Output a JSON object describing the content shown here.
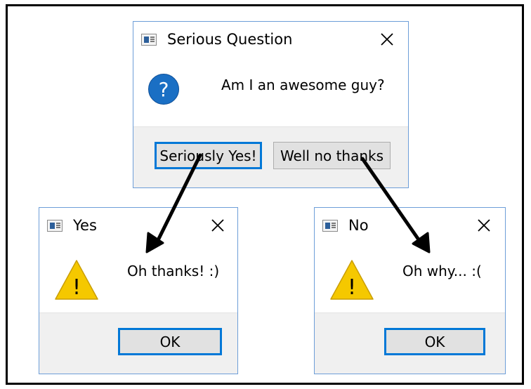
{
  "question_dialog": {
    "title": "Serious Question",
    "message": "Am I an awesome guy?",
    "yes_button": "Seriously Yes!",
    "no_button": "Well no thanks",
    "icon": "question-icon",
    "icon_glyph": "?"
  },
  "yes_dialog": {
    "title": "Yes",
    "message": "Oh thanks! :)",
    "ok_button": "OK",
    "icon": "warning-icon",
    "icon_glyph": "!"
  },
  "no_dialog": {
    "title": "No",
    "message": "Oh why... :(",
    "ok_button": "OK",
    "icon": "warning-icon",
    "icon_glyph": "!"
  },
  "colors": {
    "dialog_border": "#6d9ed8",
    "default_button_border": "#0078d7",
    "question_icon": "#1a6fc4",
    "warning_icon": "#f5c800",
    "footer": "#f0f0f0",
    "arrow": "#000000"
  }
}
